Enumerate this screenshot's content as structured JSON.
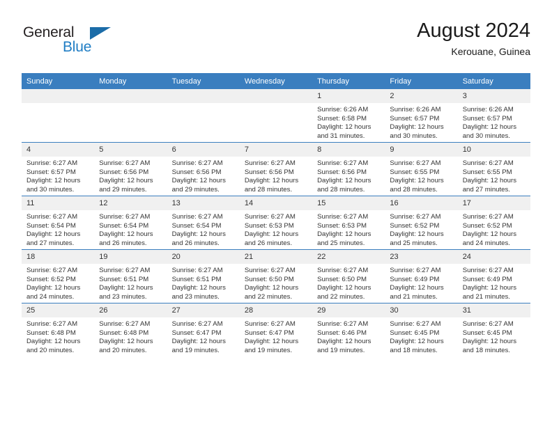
{
  "brand": {
    "name_top": "General",
    "name_bottom": "Blue",
    "triangle_color": "#1b6ca8",
    "blue_color": "#1f7dc4"
  },
  "header": {
    "title": "August 2024",
    "subtitle": "Kerouane, Guinea"
  },
  "theme": {
    "header_blue": "#3a7ebf",
    "daynum_bg": "#f0f0f0",
    "text": "#333333"
  },
  "weekdays": [
    "Sunday",
    "Monday",
    "Tuesday",
    "Wednesday",
    "Thursday",
    "Friday",
    "Saturday"
  ],
  "labels": {
    "sunrise_prefix": "Sunrise:",
    "sunset_prefix": "Sunset:",
    "daylight_prefix": "Daylight:"
  },
  "weeks": [
    [
      {
        "day": "",
        "empty": true
      },
      {
        "day": "",
        "empty": true
      },
      {
        "day": "",
        "empty": true
      },
      {
        "day": "",
        "empty": true
      },
      {
        "day": "1",
        "sunrise": "Sunrise: 6:26 AM",
        "sunset": "Sunset: 6:58 PM",
        "daylight": "Daylight: 12 hours and 31 minutes."
      },
      {
        "day": "2",
        "sunrise": "Sunrise: 6:26 AM",
        "sunset": "Sunset: 6:57 PM",
        "daylight": "Daylight: 12 hours and 30 minutes."
      },
      {
        "day": "3",
        "sunrise": "Sunrise: 6:26 AM",
        "sunset": "Sunset: 6:57 PM",
        "daylight": "Daylight: 12 hours and 30 minutes."
      }
    ],
    [
      {
        "day": "4",
        "sunrise": "Sunrise: 6:27 AM",
        "sunset": "Sunset: 6:57 PM",
        "daylight": "Daylight: 12 hours and 30 minutes."
      },
      {
        "day": "5",
        "sunrise": "Sunrise: 6:27 AM",
        "sunset": "Sunset: 6:56 PM",
        "daylight": "Daylight: 12 hours and 29 minutes."
      },
      {
        "day": "6",
        "sunrise": "Sunrise: 6:27 AM",
        "sunset": "Sunset: 6:56 PM",
        "daylight": "Daylight: 12 hours and 29 minutes."
      },
      {
        "day": "7",
        "sunrise": "Sunrise: 6:27 AM",
        "sunset": "Sunset: 6:56 PM",
        "daylight": "Daylight: 12 hours and 28 minutes."
      },
      {
        "day": "8",
        "sunrise": "Sunrise: 6:27 AM",
        "sunset": "Sunset: 6:56 PM",
        "daylight": "Daylight: 12 hours and 28 minutes."
      },
      {
        "day": "9",
        "sunrise": "Sunrise: 6:27 AM",
        "sunset": "Sunset: 6:55 PM",
        "daylight": "Daylight: 12 hours and 28 minutes."
      },
      {
        "day": "10",
        "sunrise": "Sunrise: 6:27 AM",
        "sunset": "Sunset: 6:55 PM",
        "daylight": "Daylight: 12 hours and 27 minutes."
      }
    ],
    [
      {
        "day": "11",
        "sunrise": "Sunrise: 6:27 AM",
        "sunset": "Sunset: 6:54 PM",
        "daylight": "Daylight: 12 hours and 27 minutes."
      },
      {
        "day": "12",
        "sunrise": "Sunrise: 6:27 AM",
        "sunset": "Sunset: 6:54 PM",
        "daylight": "Daylight: 12 hours and 26 minutes."
      },
      {
        "day": "13",
        "sunrise": "Sunrise: 6:27 AM",
        "sunset": "Sunset: 6:54 PM",
        "daylight": "Daylight: 12 hours and 26 minutes."
      },
      {
        "day": "14",
        "sunrise": "Sunrise: 6:27 AM",
        "sunset": "Sunset: 6:53 PM",
        "daylight": "Daylight: 12 hours and 26 minutes."
      },
      {
        "day": "15",
        "sunrise": "Sunrise: 6:27 AM",
        "sunset": "Sunset: 6:53 PM",
        "daylight": "Daylight: 12 hours and 25 minutes."
      },
      {
        "day": "16",
        "sunrise": "Sunrise: 6:27 AM",
        "sunset": "Sunset: 6:52 PM",
        "daylight": "Daylight: 12 hours and 25 minutes."
      },
      {
        "day": "17",
        "sunrise": "Sunrise: 6:27 AM",
        "sunset": "Sunset: 6:52 PM",
        "daylight": "Daylight: 12 hours and 24 minutes."
      }
    ],
    [
      {
        "day": "18",
        "sunrise": "Sunrise: 6:27 AM",
        "sunset": "Sunset: 6:52 PM",
        "daylight": "Daylight: 12 hours and 24 minutes."
      },
      {
        "day": "19",
        "sunrise": "Sunrise: 6:27 AM",
        "sunset": "Sunset: 6:51 PM",
        "daylight": "Daylight: 12 hours and 23 minutes."
      },
      {
        "day": "20",
        "sunrise": "Sunrise: 6:27 AM",
        "sunset": "Sunset: 6:51 PM",
        "daylight": "Daylight: 12 hours and 23 minutes."
      },
      {
        "day": "21",
        "sunrise": "Sunrise: 6:27 AM",
        "sunset": "Sunset: 6:50 PM",
        "daylight": "Daylight: 12 hours and 22 minutes."
      },
      {
        "day": "22",
        "sunrise": "Sunrise: 6:27 AM",
        "sunset": "Sunset: 6:50 PM",
        "daylight": "Daylight: 12 hours and 22 minutes."
      },
      {
        "day": "23",
        "sunrise": "Sunrise: 6:27 AM",
        "sunset": "Sunset: 6:49 PM",
        "daylight": "Daylight: 12 hours and 21 minutes."
      },
      {
        "day": "24",
        "sunrise": "Sunrise: 6:27 AM",
        "sunset": "Sunset: 6:49 PM",
        "daylight": "Daylight: 12 hours and 21 minutes."
      }
    ],
    [
      {
        "day": "25",
        "sunrise": "Sunrise: 6:27 AM",
        "sunset": "Sunset: 6:48 PM",
        "daylight": "Daylight: 12 hours and 20 minutes."
      },
      {
        "day": "26",
        "sunrise": "Sunrise: 6:27 AM",
        "sunset": "Sunset: 6:48 PM",
        "daylight": "Daylight: 12 hours and 20 minutes."
      },
      {
        "day": "27",
        "sunrise": "Sunrise: 6:27 AM",
        "sunset": "Sunset: 6:47 PM",
        "daylight": "Daylight: 12 hours and 19 minutes."
      },
      {
        "day": "28",
        "sunrise": "Sunrise: 6:27 AM",
        "sunset": "Sunset: 6:47 PM",
        "daylight": "Daylight: 12 hours and 19 minutes."
      },
      {
        "day": "29",
        "sunrise": "Sunrise: 6:27 AM",
        "sunset": "Sunset: 6:46 PM",
        "daylight": "Daylight: 12 hours and 19 minutes."
      },
      {
        "day": "30",
        "sunrise": "Sunrise: 6:27 AM",
        "sunset": "Sunset: 6:45 PM",
        "daylight": "Daylight: 12 hours and 18 minutes."
      },
      {
        "day": "31",
        "sunrise": "Sunrise: 6:27 AM",
        "sunset": "Sunset: 6:45 PM",
        "daylight": "Daylight: 12 hours and 18 minutes."
      }
    ]
  ]
}
